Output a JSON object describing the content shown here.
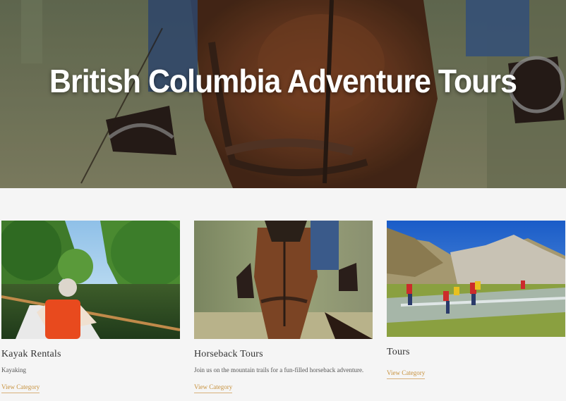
{
  "hero": {
    "title": "British Columbia Adventure Tours"
  },
  "categories": [
    {
      "title": "Kayak Rentals",
      "description": "Kayaking",
      "link": "View Category"
    },
    {
      "title": "Horseback Tours",
      "description": "Join us on the mountain trails for a fun-filled horseback adventure.",
      "link": "View Category"
    },
    {
      "title": "Tours",
      "description": "",
      "link": "View Category"
    }
  ],
  "colors": {
    "accent": "#c7923e",
    "background": "#f5f5f5",
    "text": "#333333"
  }
}
